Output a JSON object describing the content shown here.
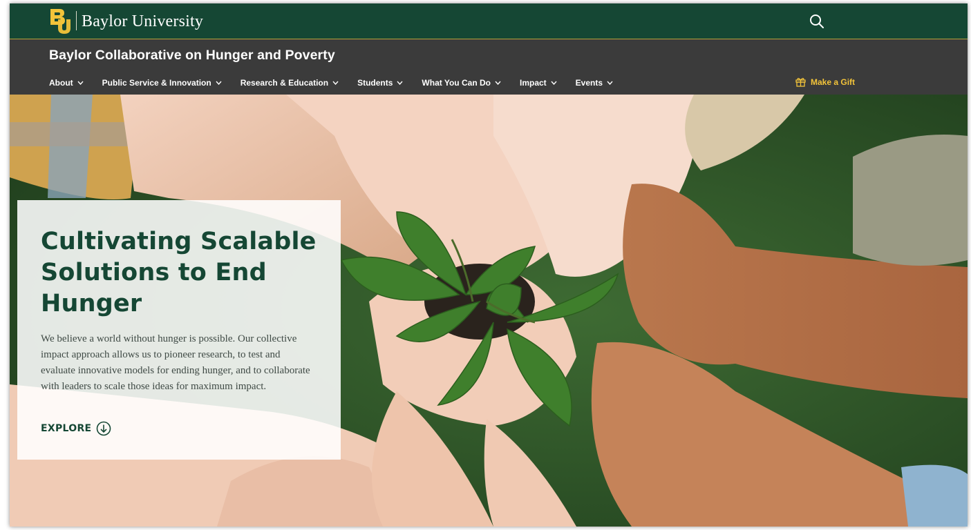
{
  "brand": {
    "university_name": "Baylor University",
    "logo_icon": "baylor-bu-logo",
    "search_icon": "search-icon",
    "colors": {
      "green": "#154734",
      "gold": "#f3c43a"
    }
  },
  "site": {
    "title": "Baylor Collaborative on Hunger and Poverty"
  },
  "nav": {
    "items": [
      {
        "label": "About"
      },
      {
        "label": "Public Service & Innovation"
      },
      {
        "label": "Research & Education"
      },
      {
        "label": "Students"
      },
      {
        "label": "What You Can Do"
      },
      {
        "label": "Impact"
      },
      {
        "label": "Events"
      }
    ],
    "gift_label": "Make a Gift",
    "gift_icon": "gift-icon"
  },
  "hero": {
    "title": "Cultivating Scalable Solutions to End Hunger",
    "body": "We believe a world without hunger is possible. Our collective impact approach allows us to pioneer research, to test and evaluate innovative models for ending hunger, and to collaborate with leaders to scale those ideas for maximum impact.",
    "cta_label": "EXPLORE",
    "cta_icon": "arrow-down-circle-icon",
    "image_icon": "hands-holding-seedling-photo"
  }
}
